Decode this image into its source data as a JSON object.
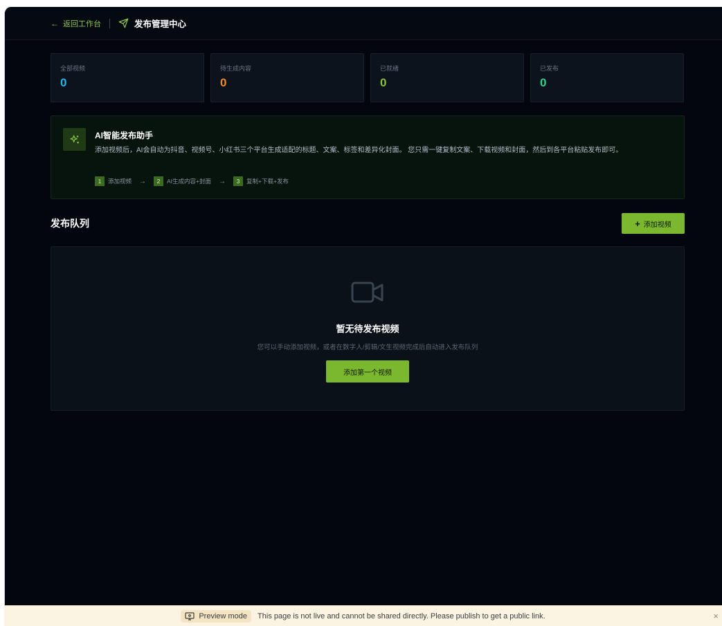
{
  "header": {
    "back_label": "返回工作台",
    "title": "发布管理中心"
  },
  "stats": [
    {
      "label": "全部视频",
      "value": "0",
      "color": "#1fb6e8"
    },
    {
      "label": "待生成内容",
      "value": "0",
      "color": "#f0882b"
    },
    {
      "label": "已就绪",
      "value": "0",
      "color": "#86c13b"
    },
    {
      "label": "已发布",
      "value": "0",
      "color": "#28d48a"
    }
  ],
  "assistant": {
    "title": "AI智能发布助手",
    "description": "添加视频后，AI会自动为抖音、视频号、小红书三个平台生成适配的标题、文案、标签和差异化封面。 您只需一键复制文案、下载视频和封面，然后到各平台粘贴发布即可。",
    "steps": [
      {
        "num": "1",
        "label": "添加视频"
      },
      {
        "num": "2",
        "label": "AI生成内容+封面"
      },
      {
        "num": "3",
        "label": "复制+下载+发布"
      }
    ],
    "arrow": "→"
  },
  "queue": {
    "title": "发布队列",
    "add_label": "添加视频",
    "plus": "+"
  },
  "empty_state": {
    "title": "暂无待发布视频",
    "description": "您可以手动添加视频，或者在数字人/剪辑/文生视频完成后自动进入发布队列",
    "button_label": "添加第一个视频"
  },
  "preview_bar": {
    "chip_label": "Preview mode",
    "message": "This page is not live and cannot be shared directly. Please publish to get a public link.",
    "close": "×"
  },
  "colors": {
    "accent": "#7cb82f",
    "background": "#03060f"
  }
}
